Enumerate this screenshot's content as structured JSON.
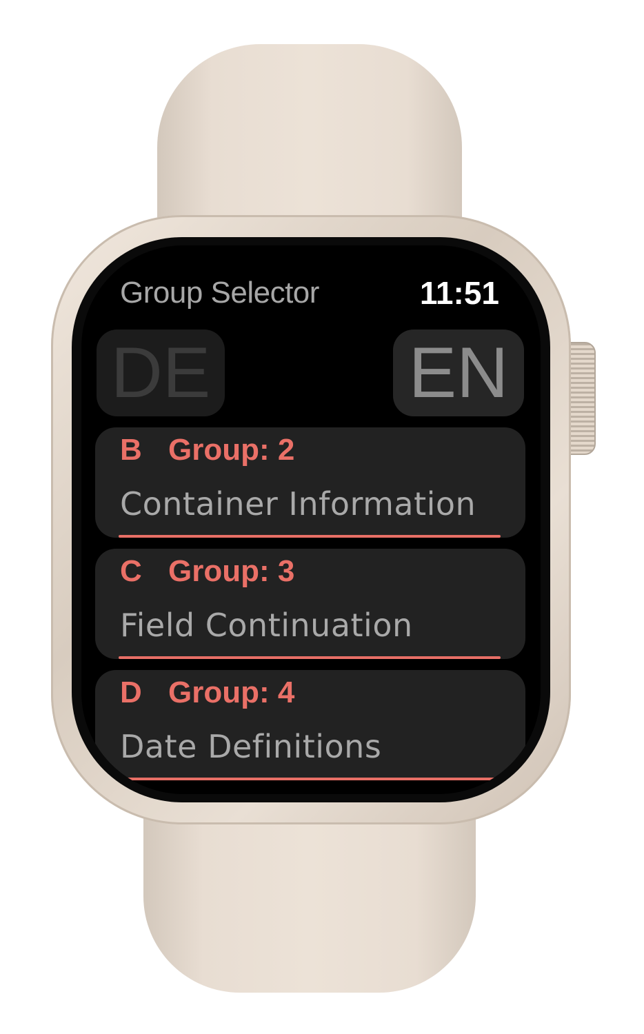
{
  "header": {
    "title": "Group Selector",
    "time": "11:51"
  },
  "languages": {
    "de_label": "DE",
    "en_label": "EN",
    "selected": "EN"
  },
  "groups": [
    {
      "letter": "B",
      "label": "Group: 2",
      "name": "Container Information"
    },
    {
      "letter": "C",
      "label": "Group: 3",
      "name": "Field Continuation"
    },
    {
      "letter": "D",
      "label": "Group: 4",
      "name": "Date Definitions"
    }
  ],
  "colors": {
    "accent": "#ea7067",
    "card_background": "#222222",
    "screen_background": "#000000",
    "subtitle_text": "#a9a9a9"
  }
}
